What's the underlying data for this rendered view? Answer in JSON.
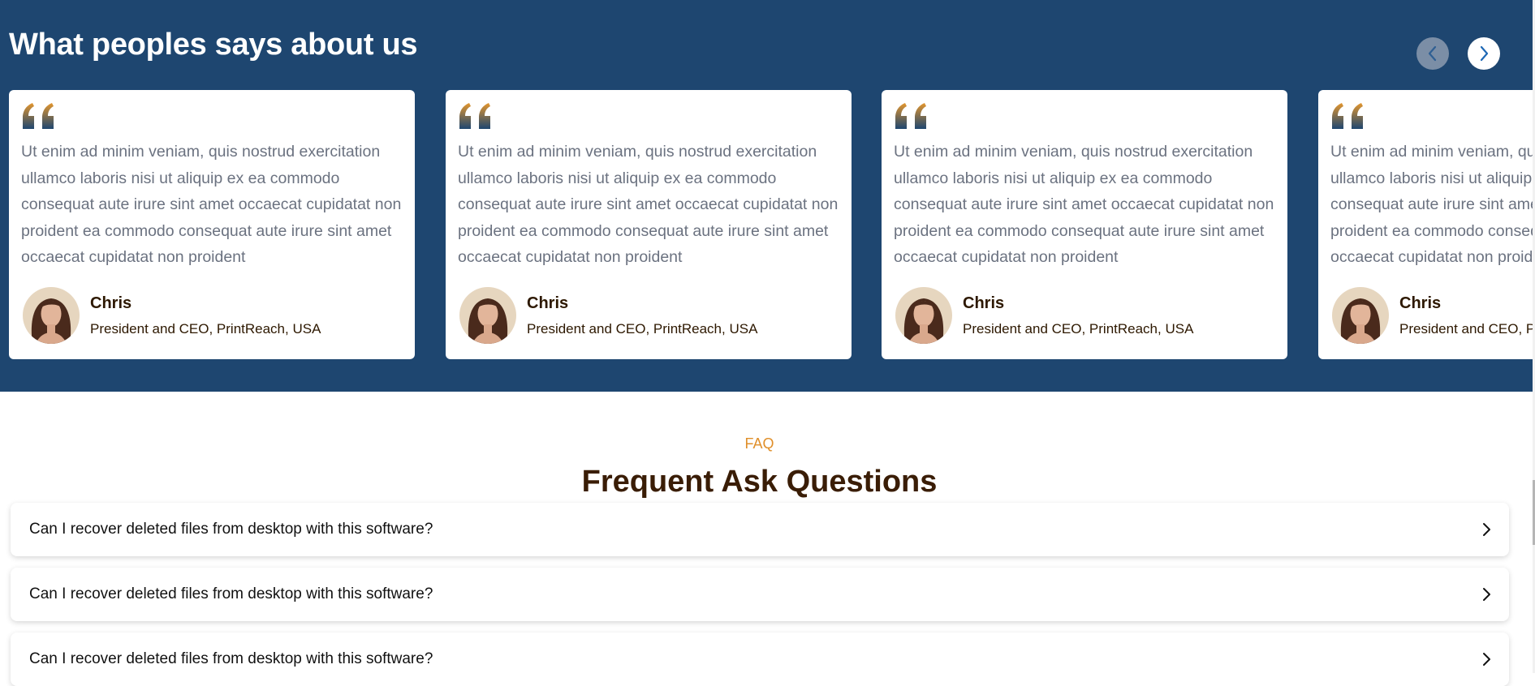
{
  "testimonials": {
    "title": "What peoples says about us",
    "cards": [
      {
        "text": "Ut enim ad minim veniam, quis nostrud exercitation ullamco laboris nisi ut aliquip ex ea commodo consequat aute irure sint amet occaecat cupidatat non proident ea commodo consequat aute irure sint amet occaecat cupidatat non proident",
        "name": "Chris",
        "role": "President and CEO, PrintReach, USA"
      },
      {
        "text": "Ut enim ad minim veniam, quis nostrud exercitation ullamco laboris nisi ut aliquip ex ea commodo consequat aute irure sint amet occaecat cupidatat non proident ea commodo consequat aute irure sint amet occaecat cupidatat non proident",
        "name": "Chris",
        "role": "President and CEO, PrintReach, USA"
      },
      {
        "text": "Ut enim ad minim veniam, quis nostrud exercitation ullamco laboris nisi ut aliquip ex ea commodo consequat aute irure sint amet occaecat cupidatat non proident ea commodo consequat aute irure sint amet occaecat cupidatat non proident",
        "name": "Chris",
        "role": "President and CEO, PrintReach, USA"
      },
      {
        "text": "Ut enim ad minim veniam, quis nostrud exercitation ullamco laboris nisi ut aliquip ex ea commodo consequat aute irure sint amet occaecat cupidatat non proident ea commodo consequat aute irure sint amet occaecat cupidatat non proident",
        "name": "Chris",
        "role": "President and CEO, PrintReach, USA"
      }
    ],
    "prev_icon": "chevron-left-icon",
    "next_icon": "chevron-right-icon"
  },
  "faq": {
    "eyebrow": "FAQ",
    "title": "Frequent Ask Questions",
    "items": [
      {
        "question": "Can I recover deleted files from desktop with this software?"
      },
      {
        "question": "Can I recover deleted files from desktop with this software?"
      },
      {
        "question": "Can I recover deleted files from desktop with this software?"
      }
    ]
  },
  "colors": {
    "section_bg": "#1e4670",
    "accent": "#e08f2a",
    "heading": "#3a1d06",
    "body_text": "#6b7280"
  }
}
